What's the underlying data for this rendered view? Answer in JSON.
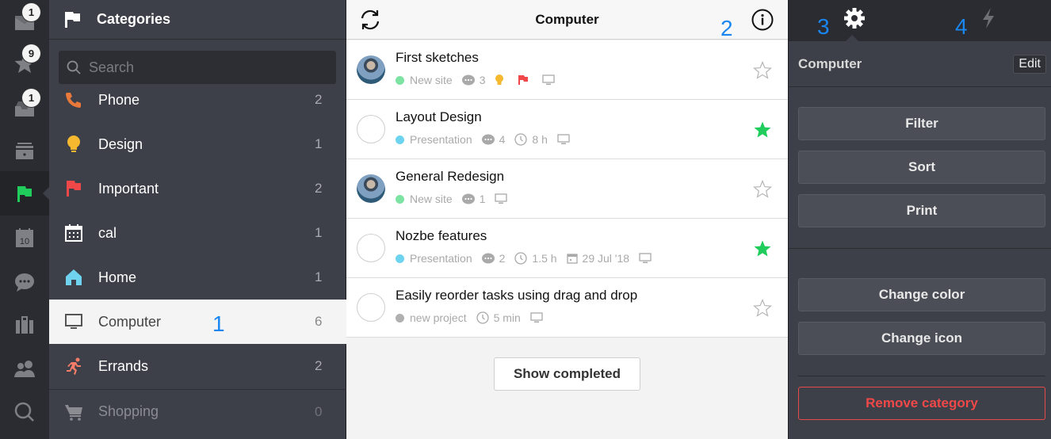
{
  "rail": {
    "items": [
      {
        "name": "inbox",
        "icon": "envelope-icon",
        "badge": "1"
      },
      {
        "name": "priority",
        "icon": "star-icon",
        "badge": "9"
      },
      {
        "name": "incoming",
        "icon": "tray-icon",
        "badge": "1"
      },
      {
        "name": "projects",
        "icon": "archive-box-icon",
        "badge": null
      },
      {
        "name": "categories",
        "icon": "flag-icon",
        "badge": null,
        "active": true
      },
      {
        "name": "calendar",
        "icon": "calendar-icon",
        "badge": null,
        "calendar_day": "10"
      },
      {
        "name": "comments",
        "icon": "chat-bubble-icon",
        "badge": null
      },
      {
        "name": "templates",
        "icon": "briefcase-icon",
        "badge": null
      },
      {
        "name": "team",
        "icon": "team-icon",
        "badge": null
      },
      {
        "name": "search",
        "icon": "search-icon",
        "badge": null
      }
    ]
  },
  "categories": {
    "title": "Categories",
    "search_placeholder": "Search",
    "items": [
      {
        "label": "Phone",
        "count": "2",
        "icon": "phone-icon",
        "color": "#e8793a"
      },
      {
        "label": "Design",
        "count": "1",
        "icon": "lightbulb-icon",
        "color": "#f5b82e"
      },
      {
        "label": "Important",
        "count": "2",
        "icon": "flag-icon",
        "color": "#f04848"
      },
      {
        "label": "cal",
        "count": "1",
        "icon": "calendar-icon",
        "color": "#ffffff"
      },
      {
        "label": "Home",
        "count": "1",
        "icon": "home-icon",
        "color": "#6fd3ef"
      },
      {
        "label": "Computer",
        "count": "6",
        "icon": "monitor-icon",
        "color": "#555555",
        "active": true
      },
      {
        "label": "Errands",
        "count": "2",
        "icon": "running-icon",
        "color": "#f47c68"
      },
      {
        "label": "Shopping",
        "count": "0",
        "icon": "cart-icon",
        "color": "#8a8c92"
      }
    ]
  },
  "annotations": {
    "a1": "1",
    "a2": "2",
    "a3": "3",
    "a4": "4"
  },
  "main": {
    "title": "Computer",
    "tasks": [
      {
        "name": "First sketches",
        "avatar": true,
        "project": "New site",
        "project_color": "#7de3a3",
        "comments": "3",
        "time": null,
        "date": null,
        "extras": [
          "lightbulb",
          "flag"
        ],
        "starred": false
      },
      {
        "name": "Layout Design",
        "avatar": false,
        "project": "Presentation",
        "project_color": "#6dd3ef",
        "comments": "4",
        "time": "8 h",
        "date": null,
        "extras": [],
        "starred": true
      },
      {
        "name": "General Redesign",
        "avatar": true,
        "project": "New site",
        "project_color": "#7de3a3",
        "comments": "1",
        "time": null,
        "date": null,
        "extras": [],
        "starred": false
      },
      {
        "name": "Nozbe features",
        "avatar": false,
        "project": "Presentation",
        "project_color": "#6dd3ef",
        "comments": "2",
        "time": "1.5 h",
        "date": "29 Jul '18",
        "extras": [],
        "starred": true
      },
      {
        "name": "Easily reorder tasks using drag and drop",
        "avatar": false,
        "project": "new project",
        "project_color": "#b0b0b0",
        "comments": null,
        "time": "5 min",
        "date": null,
        "extras": [],
        "starred": false
      }
    ],
    "show_completed_label": "Show completed"
  },
  "panel": {
    "tabs": [
      {
        "icon": "gear-icon",
        "active": true
      },
      {
        "icon": "lightning-icon",
        "active": false
      }
    ],
    "title": "Computer",
    "edit_label": "Edit",
    "buttons": {
      "filter": "Filter",
      "sort": "Sort",
      "print": "Print",
      "change_color": "Change color",
      "change_icon": "Change icon",
      "remove": "Remove category"
    }
  },
  "colors": {
    "accent_green": "#1fcc5c",
    "danger": "#f04848",
    "annotation_blue": "#1a86f0"
  }
}
